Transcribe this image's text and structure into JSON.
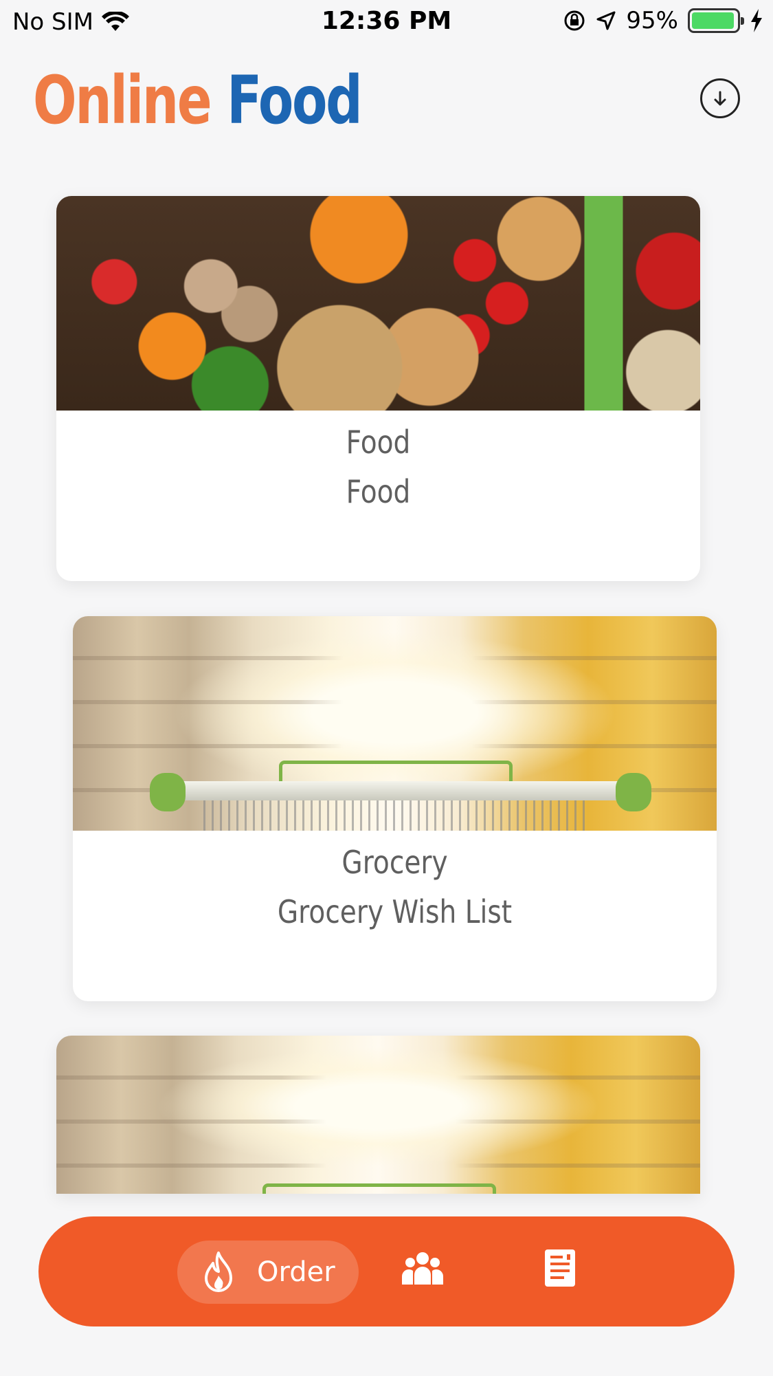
{
  "status_bar": {
    "carrier": "No SIM",
    "time": "12:36 PM",
    "battery_percent": "95%",
    "battery_level": 0.95
  },
  "header": {
    "title_part1": "Online",
    "title_part2": "Food",
    "download_icon": "download-circle-icon"
  },
  "cards": [
    {
      "title": "Food",
      "subtitle": "Food",
      "image": "food-produce-photo"
    },
    {
      "title": "Grocery",
      "subtitle": "Grocery Wish List",
      "image": "grocery-aisle-cart-photo"
    },
    {
      "title": "",
      "subtitle": "",
      "image": "grocery-aisle-cart-photo"
    }
  ],
  "bottom_nav": {
    "items": [
      {
        "label": "Order",
        "icon": "flame-icon",
        "active": true
      },
      {
        "label": "",
        "icon": "group-icon",
        "active": false
      },
      {
        "label": "",
        "icon": "receipt-icon",
        "active": false
      }
    ]
  },
  "colors": {
    "title_orange": "#ef7c45",
    "title_blue": "#1d66b3",
    "nav_background": "#f05a28",
    "battery_green": "#4cd964"
  }
}
